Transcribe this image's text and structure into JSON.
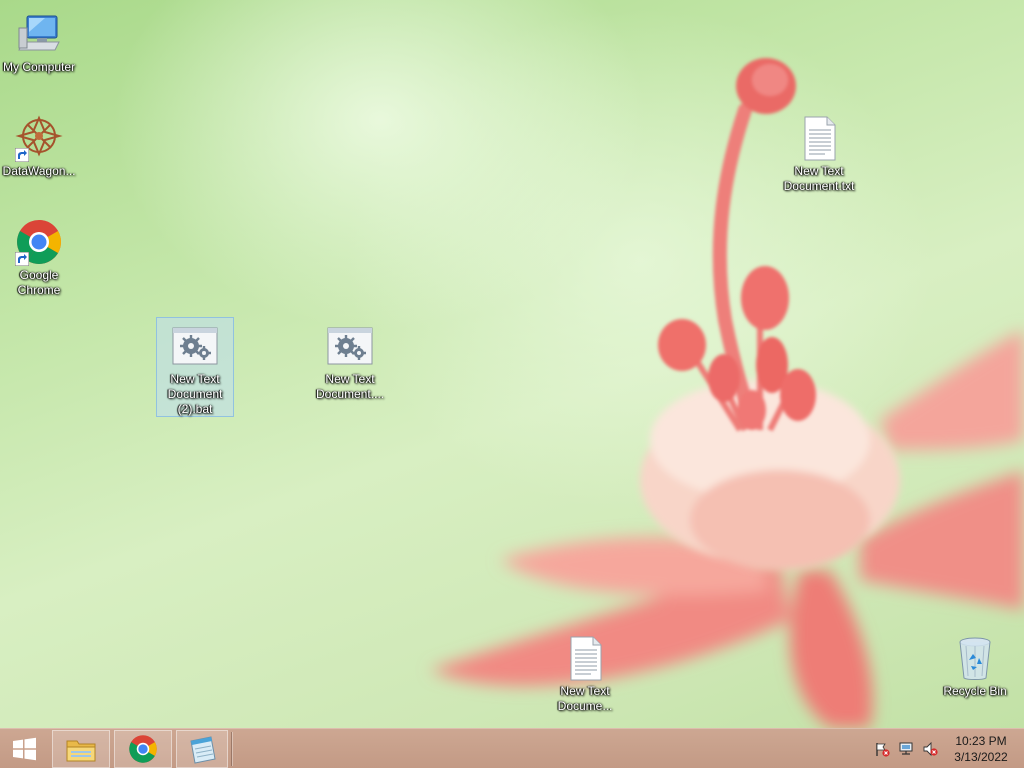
{
  "desktop": {
    "icons": [
      {
        "label": "My Computer",
        "icon": "computer-icon"
      },
      {
        "label": "DataWagon...",
        "icon": "datawagon-icon",
        "shortcut": true
      },
      {
        "label": "Google Chrome",
        "icon": "chrome-icon",
        "shortcut": true
      },
      {
        "label": "New Text Document (2).bat",
        "icon": "batch-file-icon",
        "selected": true
      },
      {
        "label": "New Text Document....",
        "icon": "batch-file-icon"
      },
      {
        "label": "New Text Document.txt",
        "icon": "text-file-icon"
      },
      {
        "label": "New Text Docume...",
        "icon": "text-file-icon"
      },
      {
        "label": "Recycle Bin",
        "icon": "recycle-bin-icon"
      }
    ]
  },
  "taskbar": {
    "pinned": [
      {
        "name": "file-explorer",
        "icon": "folder-icon"
      },
      {
        "name": "google-chrome",
        "icon": "chrome-icon"
      },
      {
        "name": "notepad",
        "icon": "notepad-icon"
      }
    ],
    "tray": {
      "icons": [
        "action-center-flag-icon",
        "network-icon",
        "volume-muted-icon"
      ],
      "time": "10:23 PM",
      "date": "3/13/2022"
    }
  },
  "colors": {
    "taskbar": "#c39a85",
    "desktop_green": "#c3e6a8",
    "flower_pink": "#f08a84"
  }
}
